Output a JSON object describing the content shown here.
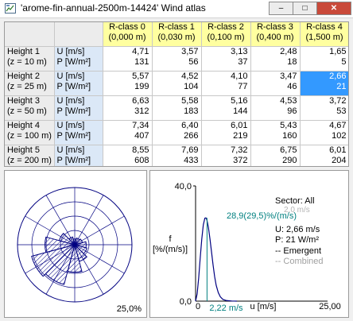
{
  "window": {
    "title": "'arome-fin-annual-2500m-14424' Wind atlas",
    "buttons": [
      "minimize",
      "maximize",
      "close"
    ]
  },
  "table": {
    "columns": [
      {
        "label": "R-class 0",
        "sub": "(0,000 m)"
      },
      {
        "label": "R-class 1",
        "sub": "(0,030 m)"
      },
      {
        "label": "R-class 2",
        "sub": "(0,100 m)"
      },
      {
        "label": "R-class 3",
        "sub": "(0,400 m)"
      },
      {
        "label": "R-class 4",
        "sub": "(1,500 m)"
      }
    ],
    "rows": [
      {
        "name": "Height 1",
        "height": "(z = 10 m)",
        "u_label": "U [m/s]",
        "p_label": "P [W/m²]",
        "u": [
          "4,71",
          "3,57",
          "3,13",
          "2,48",
          "1,65"
        ],
        "p": [
          "131",
          "56",
          "37",
          "18",
          "5"
        ]
      },
      {
        "name": "Height 2",
        "height": "(z = 25 m)",
        "u_label": "U [m/s]",
        "p_label": "P [W/m²]",
        "u": [
          "5,57",
          "4,52",
          "4,10",
          "3,47",
          "2,66"
        ],
        "p": [
          "199",
          "104",
          "77",
          "46",
          "21"
        ]
      },
      {
        "name": "Height 3",
        "height": "(z = 50 m)",
        "u_label": "U [m/s]",
        "p_label": "P [W/m²]",
        "u": [
          "6,63",
          "5,58",
          "5,16",
          "4,53",
          "3,72"
        ],
        "p": [
          "312",
          "183",
          "144",
          "96",
          "53"
        ]
      },
      {
        "name": "Height 4",
        "height": "(z = 100 m)",
        "u_label": "U [m/s]",
        "p_label": "P [W/m²]",
        "u": [
          "7,34",
          "6,40",
          "6,01",
          "5,43",
          "4,67"
        ],
        "p": [
          "407",
          "266",
          "219",
          "160",
          "102"
        ]
      },
      {
        "name": "Height 5",
        "height": "(z = 200 m)",
        "u_label": "U [m/s]",
        "p_label": "P [W/m²]",
        "u": [
          "8,55",
          "7,69",
          "7,32",
          "6,75",
          "6,01"
        ],
        "p": [
          "608",
          "433",
          "372",
          "290",
          "204"
        ]
      }
    ],
    "selected": {
      "row": 1,
      "col": 4
    }
  },
  "rose": {
    "scale_label": "25,0%",
    "colors": {
      "axis": "#000080",
      "hatch": "#000080"
    }
  },
  "chart_data": {
    "type": "line",
    "ylabel_top": "f",
    "ylabel_bottom": "[%/(m/s)]",
    "xlabel": "u [m/s]",
    "xlim": [
      0,
      25
    ],
    "ylim": [
      0,
      40
    ],
    "y_ticks": [
      "40,0",
      "0,0"
    ],
    "x_ticks": [
      "0",
      "25,00"
    ],
    "peak_label": "28,9(29,5)%/(m/s)",
    "mean_label": "2,22 m/s",
    "series": [
      {
        "color": "#000080",
        "x": [
          0,
          0.3,
          0.6,
          0.9,
          1.2,
          1.5,
          1.8,
          2.0,
          2.2,
          2.5,
          2.8,
          3.1,
          3.4,
          3.7,
          4.0,
          4.4,
          4.8,
          5.3,
          6.0,
          7.0,
          8.0
        ],
        "y": [
          0,
          2.5,
          8,
          15,
          21.5,
          26.5,
          28.8,
          28.9,
          28.2,
          25.5,
          21.5,
          17,
          12.5,
          8.5,
          5.5,
          3,
          1.5,
          0.6,
          0.2,
          0.05,
          0
        ]
      }
    ],
    "legend": {
      "sector": "Sector: All",
      "faded_line": "2,0 m/s",
      "u": "U: 2,66 m/s",
      "p": "P: 21 W/m²",
      "emergent": "-- Emergent",
      "combined": "-- Combined"
    },
    "colors": {
      "curve": "#000080",
      "peak_text": "#008080",
      "combined": "#a0a0a0",
      "faded": "#b4b4b4"
    }
  }
}
